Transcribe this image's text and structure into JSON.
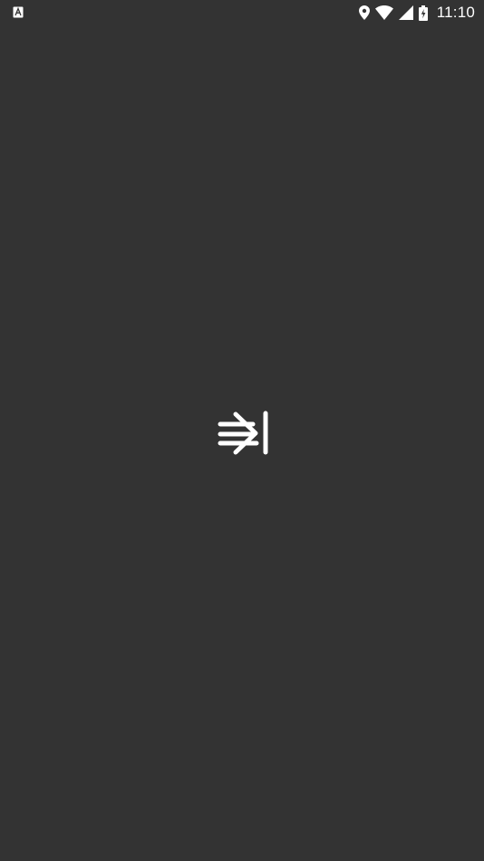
{
  "status_bar": {
    "time": "11:10",
    "icons": [
      "notification-a-icon",
      "location-icon",
      "wifi-icon",
      "signal-icon",
      "battery-charging-icon"
    ]
  },
  "splash": {
    "logo_icon": "arrow-to-bar-right-icon"
  },
  "colors": {
    "background": "#333333",
    "foreground": "#ffffff"
  }
}
